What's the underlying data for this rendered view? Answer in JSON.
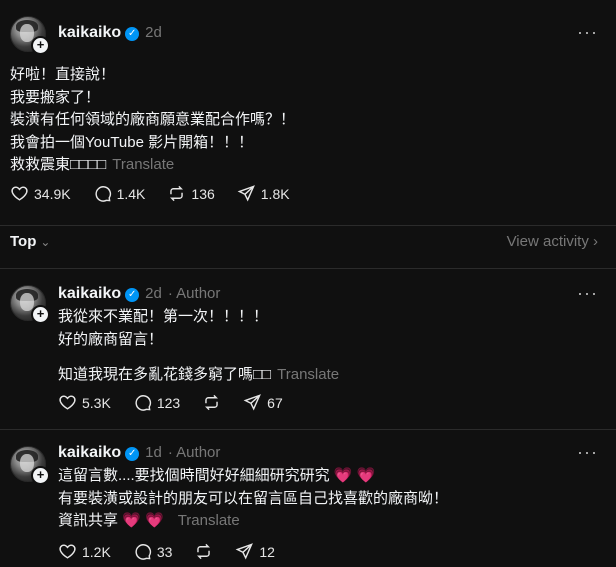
{
  "main_post": {
    "username": "kaikaiko",
    "time": "2d",
    "more": "···",
    "lines": [
      "好啦！直接說！",
      "我要搬家了！",
      "裝潢有任何領域的廠商願意業配合作嗎？！",
      "我會拍一個YouTube 影片開箱！！！",
      "救救震東□□□□"
    ],
    "translate": "Translate",
    "likes": "34.9K",
    "replies": "1.4K",
    "reposts": "136",
    "shares": "1.8K"
  },
  "sortbar": {
    "top_label": "Top",
    "view_activity": "View activity"
  },
  "replies": [
    {
      "username": "kaikaiko",
      "time": "2d",
      "role": "· Author",
      "more": "···",
      "lines": [
        "我從來不業配！第一次！！！！",
        "好的廠商留言！",
        "",
        "知道我現在多亂花錢多窮了嗎□□"
      ],
      "translate": "Translate",
      "likes": "5.3K",
      "replies": "123",
      "reposts": "",
      "shares": "67"
    },
    {
      "username": "kaikaiko",
      "time": "1d",
      "role": "· Author",
      "more": "···",
      "lines": [
        "這留言數....要找個時間好好細細研究研究 💗 💗",
        "有要裝潢或設計的朋友可以在留言區自己找喜歡的廠商呦！",
        "資訊共享 💗 💗"
      ],
      "translate": "Translate",
      "likes": "1.2K",
      "replies": "33",
      "reposts": "",
      "shares": "12"
    }
  ],
  "colors": {
    "background": "#101010",
    "text": "#f3f5f7",
    "muted": "#777777",
    "verified": "#0095f6",
    "heart": "#ff4f8b"
  }
}
